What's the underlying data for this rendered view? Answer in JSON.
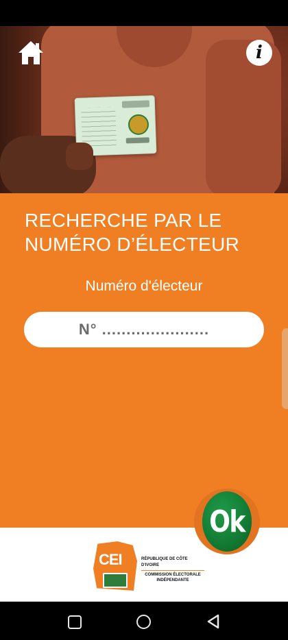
{
  "header": {
    "home_icon": "home-icon",
    "info_icon": "info-icon",
    "info_glyph": "i"
  },
  "main": {
    "title_line1": "RECHERCHE PAR LE",
    "title_line2": "NUMÉRO D’ÉLECTEUR",
    "field_label": "Numéro d'électeur",
    "input_placeholder": "N° ......................",
    "input_value": "",
    "ok_label": "Ok"
  },
  "footer": {
    "logo_abbr": "CEI",
    "logo_line1": "RÉPUBLIQUE DE CÔTE D'IVOIRE",
    "logo_line2": "COMMISSION ÉLECTORALE INDÉPENDANTE"
  },
  "colors": {
    "primary": "#ef7f22",
    "ok_green": "#137a33",
    "white": "#ffffff"
  },
  "nav": {
    "icons": [
      "recent-apps-icon",
      "home-circle-icon",
      "back-icon"
    ]
  }
}
